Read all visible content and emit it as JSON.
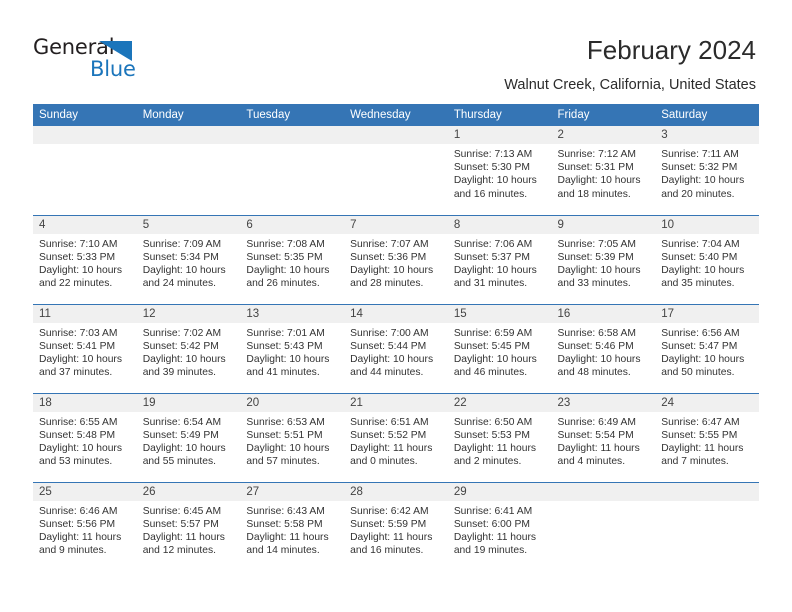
{
  "brand": {
    "name_top": "General",
    "name_bottom": "Blue",
    "accent_color": "#1b75bb"
  },
  "header": {
    "title": "February 2024",
    "subtitle": "Walnut Creek, California, United States",
    "header_bg_color": "#3575b5",
    "daystrip_color": "#f0f0f0"
  },
  "weekdays": [
    "Sunday",
    "Monday",
    "Tuesday",
    "Wednesday",
    "Thursday",
    "Friday",
    "Saturday"
  ],
  "labels": {
    "sunrise": "Sunrise:",
    "sunset": "Sunset:",
    "daylight": "Daylight:"
  },
  "weeks": [
    [
      {
        "day": "",
        "empty": true
      },
      {
        "day": "",
        "empty": true
      },
      {
        "day": "",
        "empty": true
      },
      {
        "day": "",
        "empty": true
      },
      {
        "day": "1",
        "sunrise": "Sunrise: 7:13 AM",
        "sunset": "Sunset: 5:30 PM",
        "daylight": "Daylight: 10 hours and 16 minutes."
      },
      {
        "day": "2",
        "sunrise": "Sunrise: 7:12 AM",
        "sunset": "Sunset: 5:31 PM",
        "daylight": "Daylight: 10 hours and 18 minutes."
      },
      {
        "day": "3",
        "sunrise": "Sunrise: 7:11 AM",
        "sunset": "Sunset: 5:32 PM",
        "daylight": "Daylight: 10 hours and 20 minutes."
      }
    ],
    [
      {
        "day": "4",
        "sunrise": "Sunrise: 7:10 AM",
        "sunset": "Sunset: 5:33 PM",
        "daylight": "Daylight: 10 hours and 22 minutes."
      },
      {
        "day": "5",
        "sunrise": "Sunrise: 7:09 AM",
        "sunset": "Sunset: 5:34 PM",
        "daylight": "Daylight: 10 hours and 24 minutes."
      },
      {
        "day": "6",
        "sunrise": "Sunrise: 7:08 AM",
        "sunset": "Sunset: 5:35 PM",
        "daylight": "Daylight: 10 hours and 26 minutes."
      },
      {
        "day": "7",
        "sunrise": "Sunrise: 7:07 AM",
        "sunset": "Sunset: 5:36 PM",
        "daylight": "Daylight: 10 hours and 28 minutes."
      },
      {
        "day": "8",
        "sunrise": "Sunrise: 7:06 AM",
        "sunset": "Sunset: 5:37 PM",
        "daylight": "Daylight: 10 hours and 31 minutes."
      },
      {
        "day": "9",
        "sunrise": "Sunrise: 7:05 AM",
        "sunset": "Sunset: 5:39 PM",
        "daylight": "Daylight: 10 hours and 33 minutes."
      },
      {
        "day": "10",
        "sunrise": "Sunrise: 7:04 AM",
        "sunset": "Sunset: 5:40 PM",
        "daylight": "Daylight: 10 hours and 35 minutes."
      }
    ],
    [
      {
        "day": "11",
        "sunrise": "Sunrise: 7:03 AM",
        "sunset": "Sunset: 5:41 PM",
        "daylight": "Daylight: 10 hours and 37 minutes."
      },
      {
        "day": "12",
        "sunrise": "Sunrise: 7:02 AM",
        "sunset": "Sunset: 5:42 PM",
        "daylight": "Daylight: 10 hours and 39 minutes."
      },
      {
        "day": "13",
        "sunrise": "Sunrise: 7:01 AM",
        "sunset": "Sunset: 5:43 PM",
        "daylight": "Daylight: 10 hours and 41 minutes."
      },
      {
        "day": "14",
        "sunrise": "Sunrise: 7:00 AM",
        "sunset": "Sunset: 5:44 PM",
        "daylight": "Daylight: 10 hours and 44 minutes."
      },
      {
        "day": "15",
        "sunrise": "Sunrise: 6:59 AM",
        "sunset": "Sunset: 5:45 PM",
        "daylight": "Daylight: 10 hours and 46 minutes."
      },
      {
        "day": "16",
        "sunrise": "Sunrise: 6:58 AM",
        "sunset": "Sunset: 5:46 PM",
        "daylight": "Daylight: 10 hours and 48 minutes."
      },
      {
        "day": "17",
        "sunrise": "Sunrise: 6:56 AM",
        "sunset": "Sunset: 5:47 PM",
        "daylight": "Daylight: 10 hours and 50 minutes."
      }
    ],
    [
      {
        "day": "18",
        "sunrise": "Sunrise: 6:55 AM",
        "sunset": "Sunset: 5:48 PM",
        "daylight": "Daylight: 10 hours and 53 minutes."
      },
      {
        "day": "19",
        "sunrise": "Sunrise: 6:54 AM",
        "sunset": "Sunset: 5:49 PM",
        "daylight": "Daylight: 10 hours and 55 minutes."
      },
      {
        "day": "20",
        "sunrise": "Sunrise: 6:53 AM",
        "sunset": "Sunset: 5:51 PM",
        "daylight": "Daylight: 10 hours and 57 minutes."
      },
      {
        "day": "21",
        "sunrise": "Sunrise: 6:51 AM",
        "sunset": "Sunset: 5:52 PM",
        "daylight": "Daylight: 11 hours and 0 minutes."
      },
      {
        "day": "22",
        "sunrise": "Sunrise: 6:50 AM",
        "sunset": "Sunset: 5:53 PM",
        "daylight": "Daylight: 11 hours and 2 minutes."
      },
      {
        "day": "23",
        "sunrise": "Sunrise: 6:49 AM",
        "sunset": "Sunset: 5:54 PM",
        "daylight": "Daylight: 11 hours and 4 minutes."
      },
      {
        "day": "24",
        "sunrise": "Sunrise: 6:47 AM",
        "sunset": "Sunset: 5:55 PM",
        "daylight": "Daylight: 11 hours and 7 minutes."
      }
    ],
    [
      {
        "day": "25",
        "sunrise": "Sunrise: 6:46 AM",
        "sunset": "Sunset: 5:56 PM",
        "daylight": "Daylight: 11 hours and 9 minutes."
      },
      {
        "day": "26",
        "sunrise": "Sunrise: 6:45 AM",
        "sunset": "Sunset: 5:57 PM",
        "daylight": "Daylight: 11 hours and 12 minutes."
      },
      {
        "day": "27",
        "sunrise": "Sunrise: 6:43 AM",
        "sunset": "Sunset: 5:58 PM",
        "daylight": "Daylight: 11 hours and 14 minutes."
      },
      {
        "day": "28",
        "sunrise": "Sunrise: 6:42 AM",
        "sunset": "Sunset: 5:59 PM",
        "daylight": "Daylight: 11 hours and 16 minutes."
      },
      {
        "day": "29",
        "sunrise": "Sunrise: 6:41 AM",
        "sunset": "Sunset: 6:00 PM",
        "daylight": "Daylight: 11 hours and 19 minutes."
      },
      {
        "day": "",
        "empty": true
      },
      {
        "day": "",
        "empty": true
      }
    ]
  ]
}
